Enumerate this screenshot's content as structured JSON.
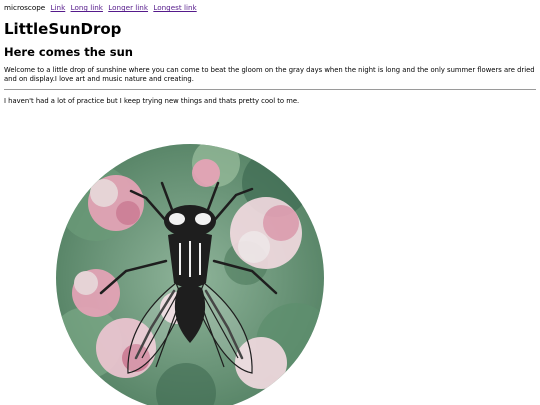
{
  "nav": {
    "image_alt": "microscope",
    "links": [
      "Link",
      "Long link",
      "Longer link",
      "Longest link"
    ]
  },
  "header": {
    "title": "LittleSunDrop",
    "subtitle": "Here comes the sun"
  },
  "main": {
    "intro": "Welcome to a little drop of sunshine where you can come to beat the gloom on the gray days when the night is long and the only summer flowers are dried and on display.I love art and music nature and creating.",
    "practice": "I haven't had a lot of practice but I keep trying new things and thats pretty cool to me."
  },
  "artwork": {
    "icon": "fly-illustration",
    "colors": {
      "foliage": "#5e8f6e",
      "petal_pink": "#e9a3b8",
      "petal_light": "#f4dbe2",
      "fly": "#1e1e1e"
    }
  }
}
